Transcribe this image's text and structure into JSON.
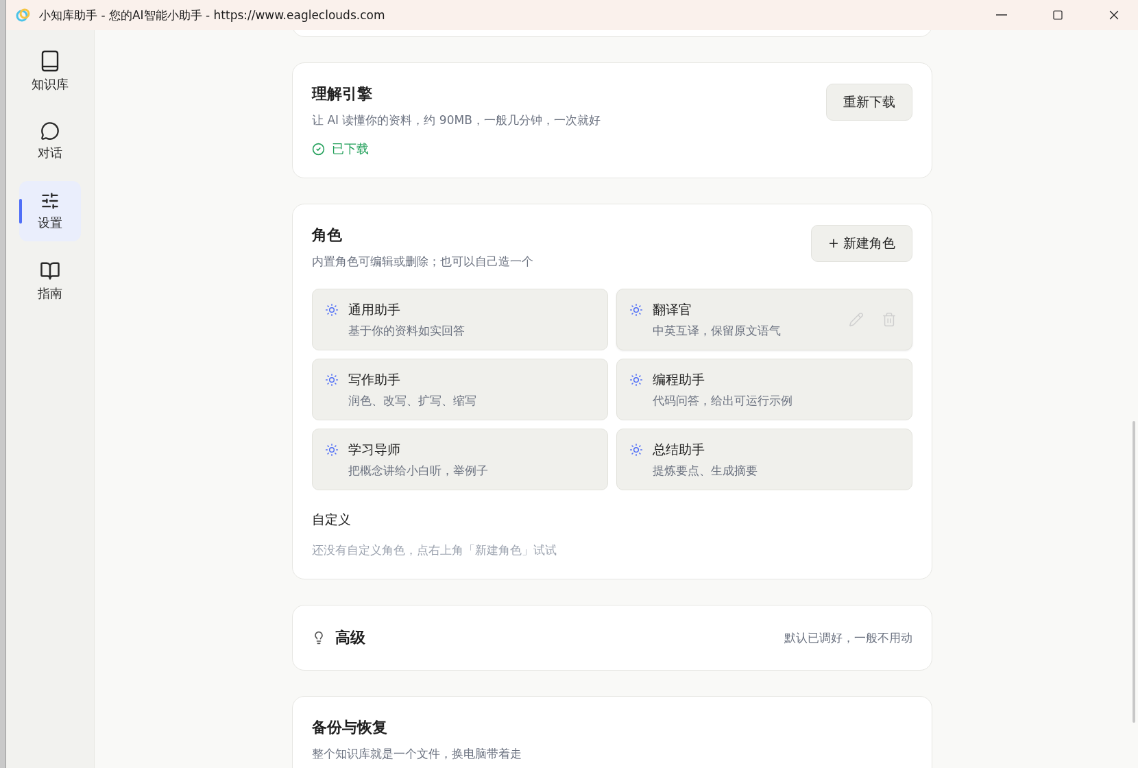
{
  "window": {
    "title": "小知库助手 - 您的AI智能小助手 - https://www.eagleclouds.com"
  },
  "sidebar": {
    "items": [
      {
        "label": "知识库",
        "selected": false
      },
      {
        "label": "对话",
        "selected": false
      },
      {
        "label": "设置",
        "selected": true
      },
      {
        "label": "指南",
        "selected": false
      }
    ]
  },
  "engine": {
    "title": "理解引擎",
    "description": "让 AI 读懂你的资料，约 90MB，一般几分钟，一次就好",
    "status": {
      "text": "已下载",
      "ok": true
    },
    "button": "重新下载"
  },
  "roles": {
    "title": "角色",
    "description": "内置角色可编辑或删除；也可以自己造一个",
    "button": "+ 新建角色",
    "items": [
      {
        "name": "通用助手",
        "description": "基于你的资料如实回答",
        "hovered": false
      },
      {
        "name": "翻译官",
        "description": "中英互译，保留原文语气",
        "hovered": true
      },
      {
        "name": "写作助手",
        "description": "润色、改写、扩写、缩写",
        "hovered": false
      },
      {
        "name": "编程助手",
        "description": "代码问答，给出可运行示例",
        "hovered": false
      },
      {
        "name": "学习导师",
        "description": "把概念讲给小白听，举例子",
        "hovered": false
      },
      {
        "name": "总结助手",
        "description": "提炼要点、生成摘要",
        "hovered": false
      }
    ],
    "custom": {
      "title": "自定义",
      "empty": "还没有自定义角色，点右上角「新建角色」试试"
    }
  },
  "advanced": {
    "title": "高级",
    "note": "默认已调好，一般不用动",
    "expanded": false
  },
  "backup": {
    "title": "备份与恢复",
    "description": "整个知识库就是一个文件，换电脑带着走"
  }
}
